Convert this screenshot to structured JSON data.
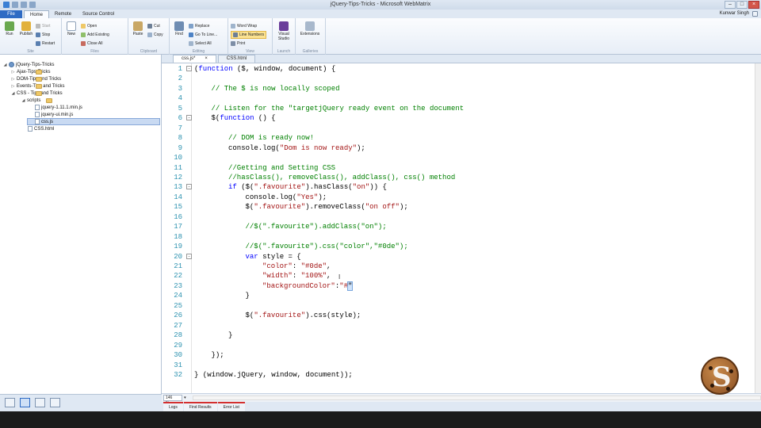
{
  "window": {
    "title": "jQuery-Tips-Tricks - Microsoft WebMatrix",
    "user": "Kunwar Singh",
    "minimize": "–",
    "maximize": "□",
    "close": "×"
  },
  "menu": {
    "file": "File",
    "tabs": [
      "Home",
      "Remote",
      "Source Control"
    ]
  },
  "ribbon": {
    "site": {
      "label": "Site",
      "run": "Run",
      "publish": "Publish",
      "start": "Start",
      "stop": "Stop",
      "restart": "Restart"
    },
    "files": {
      "label": "Files",
      "new": "New",
      "open": "Open",
      "add_existing": "Add Existing",
      "close_all": "Close All"
    },
    "clipboard": {
      "label": "Clipboard",
      "paste": "Paste",
      "cut": "Cut",
      "copy": "Copy"
    },
    "editing": {
      "label": "Editing",
      "find": "Find",
      "replace": "Replace",
      "go_to_line": "Go To Line...",
      "select_all": "Select All"
    },
    "view": {
      "label": "View",
      "word_wrap": "Word Wrap",
      "line_numbers": "Line Numbers",
      "print": "Print"
    },
    "launch": {
      "label": "Launch",
      "visual_studio": "Visual Studio"
    },
    "gallery": {
      "label": "Galleries",
      "extensions": "Extensions"
    }
  },
  "tree": [
    {
      "label": "jQuery-Tips-Tricks",
      "type": "site",
      "toggle": "◢"
    },
    {
      "label": "Ajax-Tips-Tricks",
      "type": "folder",
      "toggle": "▷"
    },
    {
      "label": "DOM-Tips and Tricks",
      "type": "folder",
      "toggle": "▷"
    },
    {
      "label": "Events-Tips and Tricks",
      "type": "folder",
      "toggle": "▷"
    },
    {
      "label": "CSS - Tips and Tricks",
      "type": "folder",
      "toggle": "◢"
    },
    {
      "label": "scripts",
      "type": "folder",
      "toggle": "◢"
    },
    {
      "label": "jquery-1.11.1.min.js",
      "type": "file",
      "toggle": ""
    },
    {
      "label": "jquery-ui.min.js",
      "type": "file",
      "toggle": ""
    },
    {
      "label": "css.js",
      "type": "file",
      "toggle": ""
    },
    {
      "label": "CSS.html",
      "type": "file",
      "toggle": ""
    }
  ],
  "doc_tabs": [
    {
      "label": "css.js*",
      "close": "×"
    },
    {
      "label": "CSS.html",
      "close": ""
    }
  ],
  "editor": {
    "lines": [
      {
        "n": "1",
        "fold": "-",
        "indent": 0,
        "parts": [
          {
            "t": "(",
            "c": ""
          },
          {
            "t": "function",
            "c": "kw"
          },
          {
            "t": " ($, window, document) {",
            "c": ""
          }
        ]
      },
      {
        "n": "2",
        "fold": "",
        "indent": 0,
        "parts": []
      },
      {
        "n": "3",
        "fold": "",
        "indent": 1,
        "parts": [
          {
            "t": "// The $ is now locally scoped",
            "c": "cm"
          }
        ]
      },
      {
        "n": "4",
        "fold": "",
        "indent": 0,
        "parts": []
      },
      {
        "n": "5",
        "fold": "",
        "indent": 1,
        "parts": [
          {
            "t": "// Listen for the \"targetjQuery ready event on the document",
            "c": "cm"
          }
        ]
      },
      {
        "n": "6",
        "fold": "-",
        "indent": 1,
        "parts": [
          {
            "t": "$(",
            "c": ""
          },
          {
            "t": "function",
            "c": "kw"
          },
          {
            "t": " () {",
            "c": ""
          }
        ]
      },
      {
        "n": "7",
        "fold": "",
        "indent": 0,
        "parts": []
      },
      {
        "n": "8",
        "fold": "",
        "indent": 2,
        "parts": [
          {
            "t": "// DOM is ready now!",
            "c": "cm"
          }
        ]
      },
      {
        "n": "9",
        "fold": "",
        "indent": 2,
        "parts": [
          {
            "t": "console.log(",
            "c": ""
          },
          {
            "t": "\"Dom is now ready\"",
            "c": "str"
          },
          {
            "t": ");",
            "c": ""
          }
        ]
      },
      {
        "n": "10",
        "fold": "",
        "indent": 0,
        "parts": []
      },
      {
        "n": "11",
        "fold": "",
        "indent": 2,
        "parts": [
          {
            "t": "//Getting and Setting CSS",
            "c": "cm"
          }
        ]
      },
      {
        "n": "12",
        "fold": "",
        "indent": 2,
        "parts": [
          {
            "t": "//hasClass(), removeClass(), addClass(), css() method",
            "c": "cm"
          }
        ]
      },
      {
        "n": "13",
        "fold": "-",
        "indent": 2,
        "parts": [
          {
            "t": "if",
            "c": "kw"
          },
          {
            "t": " ($(",
            "c": ""
          },
          {
            "t": "\".favourite\"",
            "c": "str"
          },
          {
            "t": ").hasClass(",
            "c": ""
          },
          {
            "t": "\"on\"",
            "c": "str"
          },
          {
            "t": ")) {",
            "c": ""
          }
        ]
      },
      {
        "n": "14",
        "fold": "",
        "indent": 3,
        "parts": [
          {
            "t": "console.log(",
            "c": ""
          },
          {
            "t": "\"Yes\"",
            "c": "str"
          },
          {
            "t": ");",
            "c": ""
          }
        ]
      },
      {
        "n": "15",
        "fold": "",
        "indent": 3,
        "parts": [
          {
            "t": "$(",
            "c": ""
          },
          {
            "t": "\".favourite\"",
            "c": "str"
          },
          {
            "t": ").removeClass(",
            "c": ""
          },
          {
            "t": "\"on off\"",
            "c": "str"
          },
          {
            "t": ");",
            "c": ""
          }
        ]
      },
      {
        "n": "16",
        "fold": "",
        "indent": 0,
        "parts": []
      },
      {
        "n": "17",
        "fold": "",
        "indent": 3,
        "parts": [
          {
            "t": "//$(\".favourite\").addClass(\"on\");",
            "c": "cm"
          }
        ]
      },
      {
        "n": "18",
        "fold": "",
        "indent": 0,
        "parts": []
      },
      {
        "n": "19",
        "fold": "",
        "indent": 3,
        "parts": [
          {
            "t": "//$(\".favourite\").css(\"color\",\"#0de\");",
            "c": "cm"
          }
        ]
      },
      {
        "n": "20",
        "fold": "-",
        "indent": 3,
        "parts": [
          {
            "t": "var",
            "c": "kw"
          },
          {
            "t": " style = {",
            "c": ""
          }
        ]
      },
      {
        "n": "21",
        "fold": "",
        "indent": 4,
        "parts": [
          {
            "t": "\"color\"",
            "c": "str"
          },
          {
            "t": ": ",
            "c": ""
          },
          {
            "t": "\"#0de\"",
            "c": "str"
          },
          {
            "t": ",",
            "c": ""
          }
        ]
      },
      {
        "n": "22",
        "fold": "",
        "indent": 4,
        "parts": [
          {
            "t": "\"width\"",
            "c": "str"
          },
          {
            "t": ": ",
            "c": ""
          },
          {
            "t": "\"100%\"",
            "c": "str"
          },
          {
            "t": ",",
            "c": ""
          }
        ]
      },
      {
        "n": "23",
        "fold": "",
        "indent": 4,
        "parts": [
          {
            "t": "\"backgroundColor\"",
            "c": "str"
          },
          {
            "t": ":",
            "c": ""
          },
          {
            "t": "\"#",
            "c": "str"
          },
          {
            "t": "\"",
            "c": "sel"
          }
        ]
      },
      {
        "n": "24",
        "fold": "",
        "indent": 3,
        "parts": [
          {
            "t": "}",
            "c": ""
          }
        ]
      },
      {
        "n": "25",
        "fold": "",
        "indent": 0,
        "parts": []
      },
      {
        "n": "26",
        "fold": "",
        "indent": 3,
        "parts": [
          {
            "t": "$(",
            "c": ""
          },
          {
            "t": "\".favourite\"",
            "c": "str"
          },
          {
            "t": ").css(style);",
            "c": ""
          }
        ]
      },
      {
        "n": "27",
        "fold": "",
        "indent": 0,
        "parts": []
      },
      {
        "n": "28",
        "fold": "",
        "indent": 2,
        "parts": [
          {
            "t": "}",
            "c": ""
          }
        ]
      },
      {
        "n": "29",
        "fold": "",
        "indent": 0,
        "parts": []
      },
      {
        "n": "30",
        "fold": "",
        "indent": 1,
        "parts": [
          {
            "t": "});",
            "c": ""
          }
        ]
      },
      {
        "n": "31",
        "fold": "",
        "indent": 0,
        "parts": []
      },
      {
        "n": "32",
        "fold": "",
        "indent": 0,
        "parts": [
          {
            "t": "} (window.jQuery, window, document));",
            "c": ""
          }
        ]
      }
    ]
  },
  "zoom": "146 %",
  "panel_tabs": [
    "Logs",
    "Find Results",
    "Error List"
  ],
  "colors": {
    "accent": "#2f6bc4",
    "comment": "#008000",
    "string": "#a31515",
    "keyword": "#0000ff",
    "line_number": "#2b91af"
  },
  "watermark": {
    "letter": "S"
  }
}
